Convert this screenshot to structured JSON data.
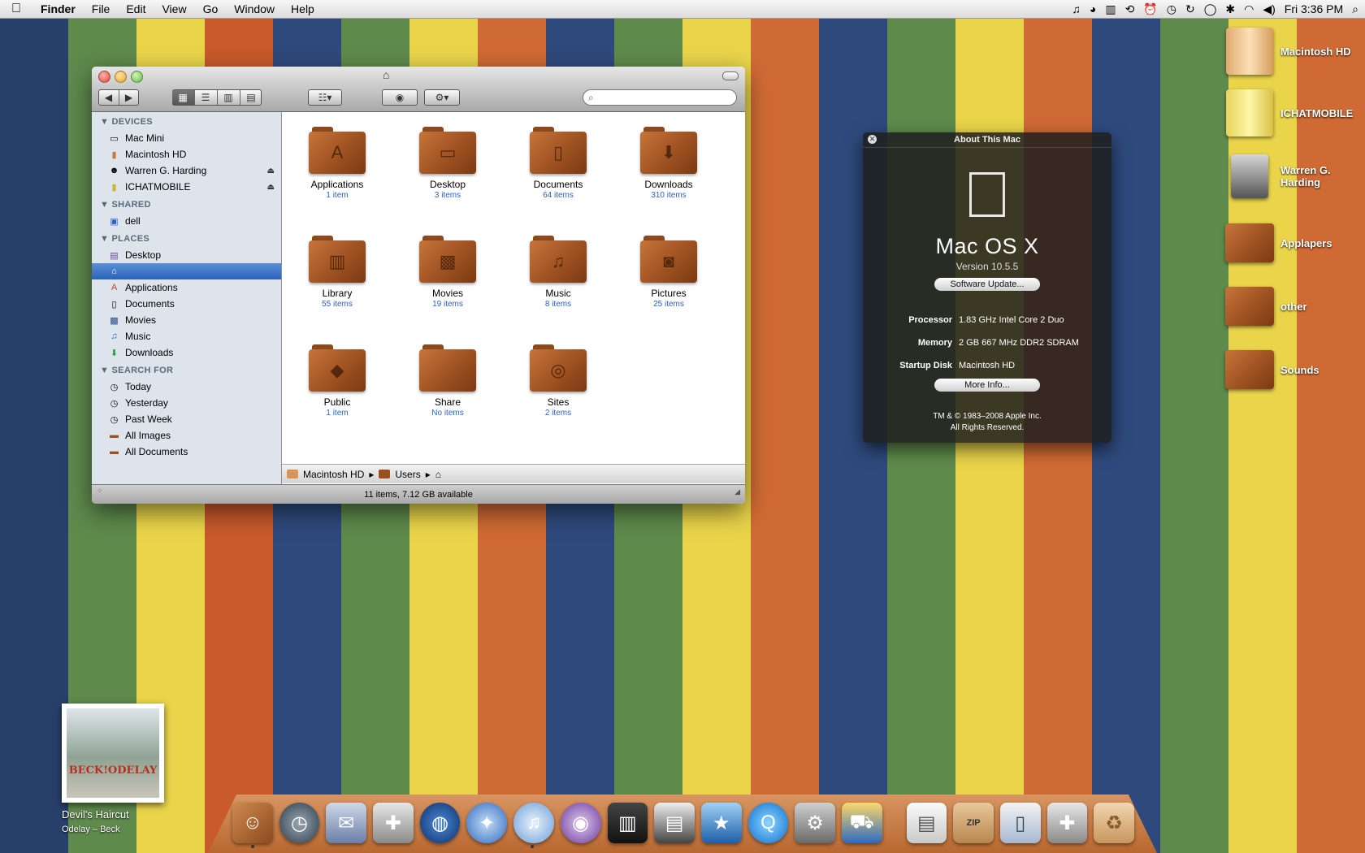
{
  "wallpaper": {
    "colors": [
      "#283f6a",
      "#5e8a4c",
      "#e9d44a",
      "#c85a2c",
      "#2e4a7c",
      "#5e8a4c",
      "#e9d44a",
      "#cf6a34",
      "#2e4a7c",
      "#5e8a4c",
      "#e9d44a",
      "#cf6a34",
      "#2e4a7c",
      "#5e8a4c",
      "#e9d44a",
      "#cf6a34",
      "#2e4a7c",
      "#5e8a4c",
      "#e9d44a",
      "#cf6a34"
    ]
  },
  "menubar": {
    "apple": "",
    "app_name": "Finder",
    "items": [
      "File",
      "Edit",
      "View",
      "Go",
      "Window",
      "Help"
    ],
    "clock": "Fri 3:36 PM"
  },
  "finder": {
    "search_placeholder": "",
    "sidebar": {
      "devices_header": "DEVICES",
      "devices": [
        "Mac Mini",
        "Macintosh HD",
        "Warren G. Harding",
        "ICHATMOBILE"
      ],
      "shared_header": "SHARED",
      "shared": [
        "dell"
      ],
      "places_header": "PLACES",
      "places": [
        "Desktop",
        "",
        "Applications",
        "Documents",
        "Movies",
        "Music",
        "Downloads"
      ],
      "search_header": "SEARCH FOR",
      "search": [
        "Today",
        "Yesterday",
        "Past Week",
        "All Images",
        "All Documents"
      ]
    },
    "items": [
      {
        "name": "Applications",
        "count": "1 item",
        "icon": "app-store-a-icon"
      },
      {
        "name": "Desktop",
        "count": "3 items",
        "icon": "desktop-icon"
      },
      {
        "name": "Documents",
        "count": "64 items",
        "icon": "document-icon"
      },
      {
        "name": "Downloads",
        "count": "310 items",
        "icon": "download-arrow-icon"
      },
      {
        "name": "Library",
        "count": "55 items",
        "icon": "library-columns-icon"
      },
      {
        "name": "Movies",
        "count": "19 items",
        "icon": "film-icon"
      },
      {
        "name": "Music",
        "count": "8 items",
        "icon": "music-note-icon"
      },
      {
        "name": "Pictures",
        "count": "25 items",
        "icon": "camera-icon"
      },
      {
        "name": "Public",
        "count": "1 item",
        "icon": "public-sign-icon"
      },
      {
        "name": "Share",
        "count": "No items",
        "icon": "folder-icon"
      },
      {
        "name": "Sites",
        "count": "2 items",
        "icon": "www-icon"
      }
    ],
    "path": [
      "Macintosh HD",
      "Users"
    ],
    "status": "11 items, 7.12 GB available"
  },
  "about": {
    "title": "About This Mac",
    "os_name": "Mac OS X",
    "version": "Version 10.5.5",
    "software_update": "Software Update...",
    "specs": [
      {
        "label": "Processor",
        "value": "1.83 GHz Intel Core 2 Duo"
      },
      {
        "label": "Memory",
        "value": "2 GB 667 MHz DDR2 SDRAM"
      },
      {
        "label": "Startup Disk",
        "value": "Macintosh HD"
      }
    ],
    "more_info": "More Info...",
    "copyright_1": "TM & © 1983–2008 Apple Inc.",
    "copyright_2": "All Rights Reserved."
  },
  "desktop_icons": [
    {
      "label": "Macintosh HD",
      "kind": "drive"
    },
    {
      "label": "ICHATMOBILE",
      "kind": "drive-yellow"
    },
    {
      "label": "Warren G. Harding",
      "kind": "user"
    },
    {
      "label": "Applapers",
      "kind": "folder"
    },
    {
      "label": "other",
      "kind": "folder"
    },
    {
      "label": "Sounds",
      "kind": "folder"
    }
  ],
  "now_playing": {
    "art_text": "BECK!ODELAY",
    "title": "Devil's Haircut",
    "subtitle": "Odelay – Beck"
  },
  "dock": {
    "zip_label": "ZIP"
  }
}
